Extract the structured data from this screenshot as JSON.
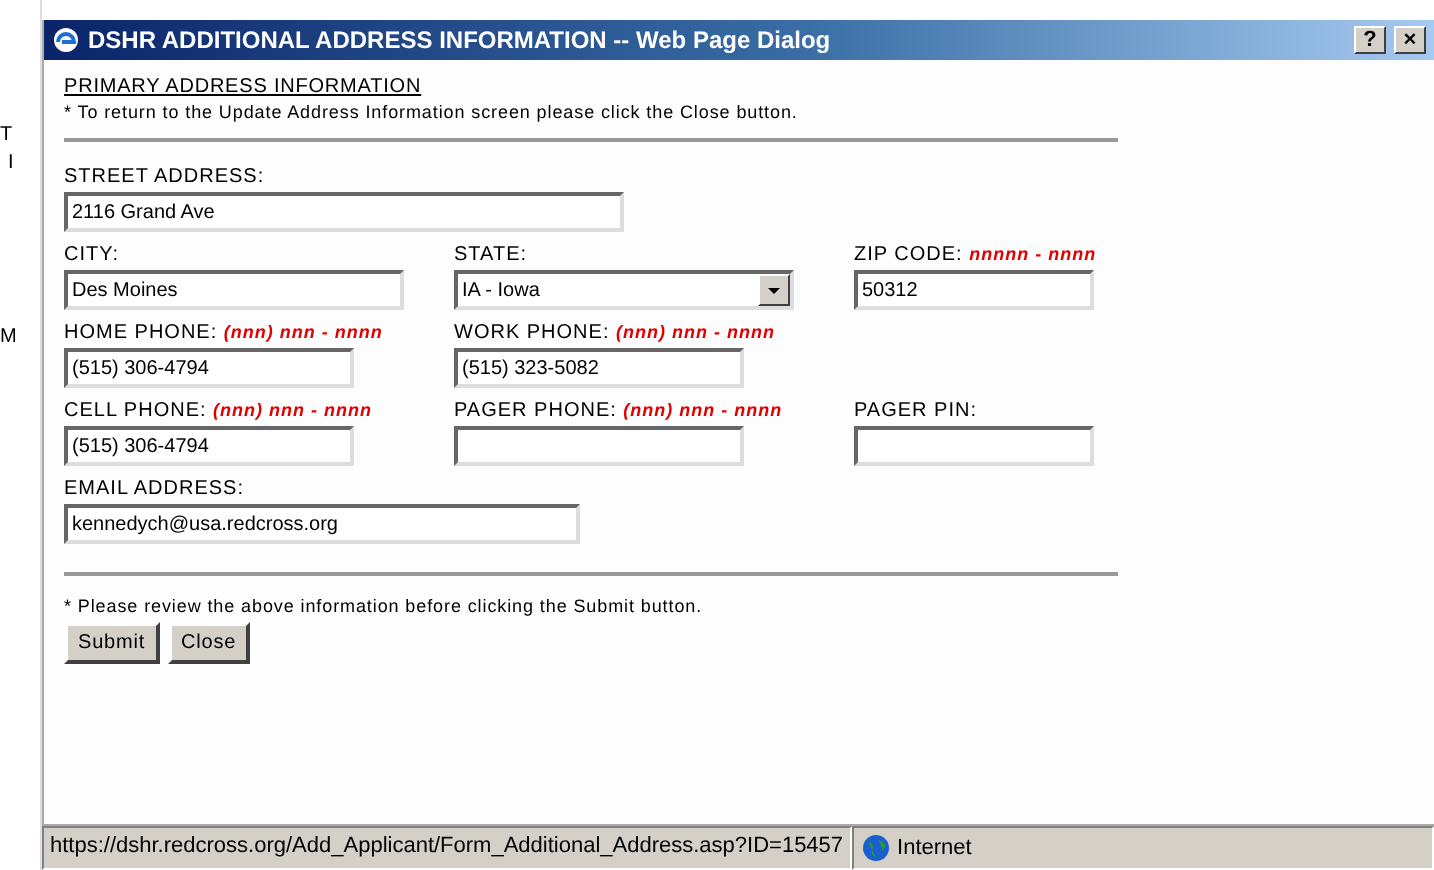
{
  "background_fragments": [
    "T",
    "I",
    "M"
  ],
  "window": {
    "title": "DSHR ADDITIONAL ADDRESS INFORMATION -- Web Page Dialog",
    "buttons": [
      "?",
      "×"
    ]
  },
  "heading": "PRIMARY ADDRESS INFORMATION",
  "intro_note": "* To return to the Update Address Information screen please click the Close button.",
  "form_rows": [
    {
      "fields": [
        {
          "kind": "text",
          "label": "STREET ADDRESS:",
          "value": "2116 Grand Ave"
        }
      ]
    },
    {
      "fields": [
        {
          "kind": "text",
          "label": "CITY:",
          "value": "Des Moines"
        },
        {
          "kind": "select",
          "label": "STATE:",
          "value": "IA - Iowa"
        },
        {
          "kind": "text",
          "label": "ZIP CODE:",
          "hint": "nnnnn - nnnn",
          "value": "50312"
        }
      ]
    },
    {
      "fields": [
        {
          "kind": "text",
          "label": "HOME PHONE:",
          "hint": "(nnn) nnn - nnnn",
          "value": "(515) 306-4794"
        },
        {
          "kind": "text",
          "label": "WORK PHONE:",
          "hint": "(nnn) nnn - nnnn",
          "value": "(515) 323-5082"
        }
      ]
    },
    {
      "fields": [
        {
          "kind": "text",
          "label": "CELL PHONE:",
          "hint": "(nnn) nnn - nnnn",
          "value": "(515) 306-4794"
        },
        {
          "kind": "text",
          "label": "PAGER PHONE:",
          "hint": "(nnn) nnn - nnnn"
        },
        {
          "kind": "text",
          "label": "PAGER PIN:"
        }
      ]
    },
    {
      "fields": [
        {
          "kind": "text",
          "label": "EMAIL ADDRESS:",
          "value": "kennedych@usa.redcross.org"
        }
      ]
    }
  ],
  "footer_note": "* Please review the above information before clicking the Submit button.",
  "buttons": [
    "Submit",
    "Close"
  ],
  "status_bar": {
    "url": "https://dshr.redcross.org/Add_Applicant/Form_Additional_Address.asp?ID=15457",
    "zone": "Internet"
  }
}
